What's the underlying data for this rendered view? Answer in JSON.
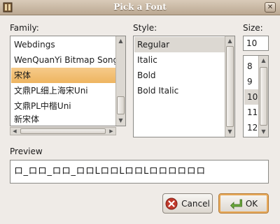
{
  "window": {
    "title": "Pick a Font"
  },
  "family": {
    "label": "Family:",
    "items": [
      "Webdings",
      "WenQuanYi Bitmap Song",
      "宋体",
      "文鼎PL细上海宋Uni",
      "文鼎PL中楷Uni",
      "新宋体"
    ],
    "selected_index": 2
  },
  "style": {
    "label": "Style:",
    "items": [
      "Regular",
      "Italic",
      "Bold",
      "Bold Italic"
    ],
    "selected_index": 0
  },
  "size": {
    "label": "Size:",
    "value": "10",
    "items": [
      "8",
      "9",
      "10",
      "11",
      "12"
    ],
    "selected_index": 2
  },
  "preview": {
    "label": "Preview",
    "text": "ロ_ロロ_ロロ_ロロLロロLロロLロロロロロロ"
  },
  "buttons": {
    "cancel": "Cancel",
    "ok": "OK"
  },
  "icons": {
    "app": "font-picker-icon",
    "close": "close-icon",
    "cancel": "cancel-icon",
    "ok": "ok-arrow-icon"
  },
  "colors": {
    "selection": "#eeb560",
    "titlebar": "#c8b8a4",
    "ok_arrow": "#6aa83a",
    "cancel_icon": "#c0392b"
  }
}
